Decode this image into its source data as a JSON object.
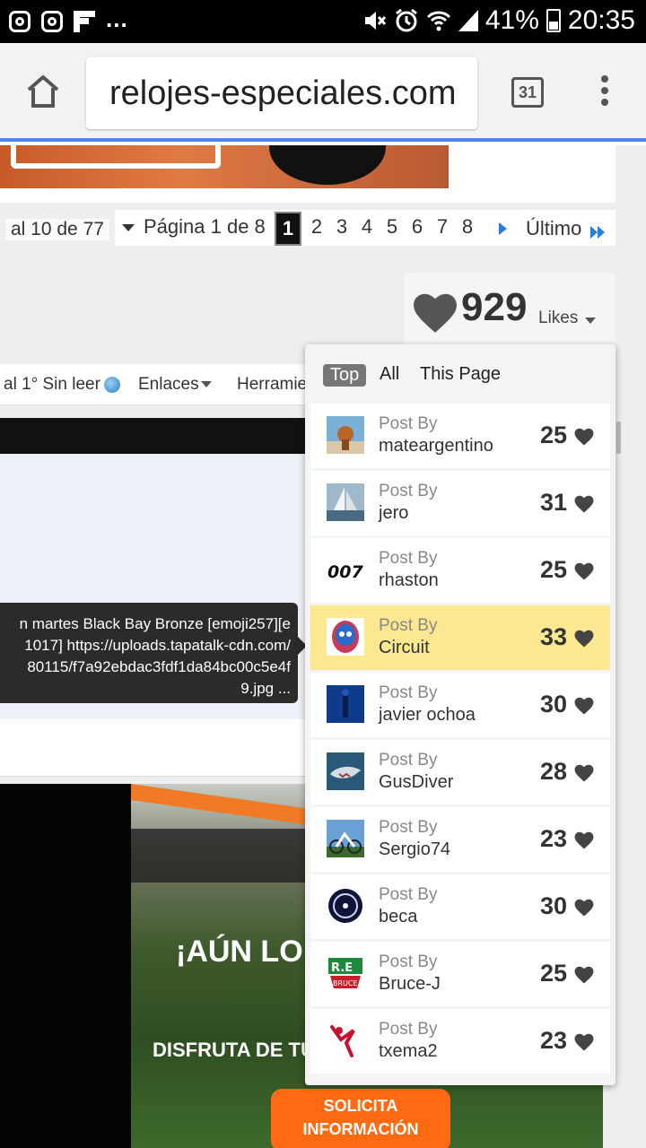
{
  "status_bar": {
    "battery": "41%",
    "time": "20:35"
  },
  "browser": {
    "url": "relojes-especiales.com",
    "tab_count": "31"
  },
  "pagination": {
    "range": "al 10 de 77",
    "label": "Página 1 de 8",
    "pages": [
      "1",
      "2",
      "3",
      "4",
      "5",
      "6",
      "7",
      "8"
    ],
    "current": "1",
    "last": "Último"
  },
  "likes": {
    "count": "929",
    "label": "Likes"
  },
  "forum_nav": {
    "unread": "al 1° Sin leer",
    "links": "Enlaces",
    "tools": "Herramie"
  },
  "tooltip": {
    "lines": [
      "n martes Black Bay Bronze [emoji257][e",
      "1017] https://uploads.tapatalk-cdn.com/",
      "80115/f7a92ebdac3fdf1da84bc00c5e4f",
      "9.jpg ..."
    ]
  },
  "ad": {
    "title": "¡AÚN LO",
    "subtitle": "DISFRUTA DE TU",
    "cta_line1": "SOLICITA",
    "cta_line2": "INFORMACIÓN"
  },
  "dropdown": {
    "tabs": [
      "Top",
      "All",
      "This Page"
    ],
    "post_by_label": "Post By",
    "rows": [
      {
        "user": "mateargentino",
        "count": "25",
        "avatar": "statue"
      },
      {
        "user": "jero",
        "count": "31",
        "avatar": "sailboat"
      },
      {
        "user": "rhaston",
        "count": "25",
        "avatar": "007"
      },
      {
        "user": "Circuit",
        "count": "33",
        "avatar": "helmet",
        "highlight": true
      },
      {
        "user": "javier ochoa",
        "count": "30",
        "avatar": "diver"
      },
      {
        "user": "GusDiver",
        "count": "28",
        "avatar": "shark"
      },
      {
        "user": "Sergio74",
        "count": "23",
        "avatar": "cyclist"
      },
      {
        "user": "beca",
        "count": "30",
        "avatar": "badge"
      },
      {
        "user": "Bruce-J",
        "count": "25",
        "avatar": "re-bruce"
      },
      {
        "user": "txema2",
        "count": "23",
        "avatar": "figure"
      }
    ]
  },
  "avatar_text": {
    "bond": "007",
    "re": "R.E",
    "bruce": "BRUCE"
  },
  "colors": {
    "accent_blue": "#4a86e8",
    "highlight_row": "#fce890",
    "cta_orange": "#ff6a13"
  }
}
